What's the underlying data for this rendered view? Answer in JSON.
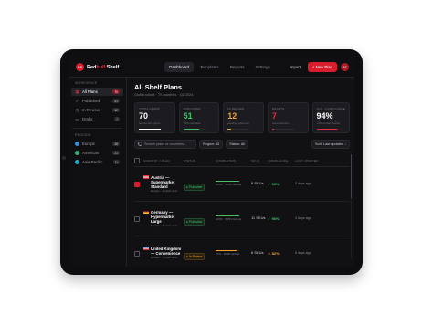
{
  "app": {
    "logo_badge": "RB",
    "brand_prefix": "Red",
    "brand_accent": "bull",
    "brand_suffix": " Shelf"
  },
  "nav": {
    "tabs": [
      "Dashboard",
      "Templates",
      "Reports",
      "Settings"
    ],
    "active_tab": "Dashboard"
  },
  "header_actions": {
    "import_label": "Import",
    "new_plan_label": "+ New Plan",
    "avatar_initials": "AT"
  },
  "sidebar": {
    "workspace_title": "WORKSPACE",
    "items": [
      {
        "label": "All Plans",
        "count": "70",
        "active": true,
        "icon": "grid-icon"
      },
      {
        "label": "Published",
        "count": "51",
        "active": false,
        "icon": "check-icon"
      },
      {
        "label": "In Review",
        "count": "12",
        "active": false,
        "icon": "clock-icon"
      },
      {
        "label": "Drafts",
        "count": "7",
        "active": false,
        "icon": "doc-icon"
      }
    ],
    "regions_title": "REGIONS",
    "regions": [
      {
        "label": "Europe",
        "count": "38",
        "color": "#3a8fd8"
      },
      {
        "label": "Americas",
        "count": "21",
        "color": "#36b37e"
      },
      {
        "label": "Asia-Pacific",
        "count": "11",
        "color": "#2ba6c9"
      }
    ]
  },
  "main": {
    "title": "All Shelf Plans",
    "subtitle": "Global rollout · 70 countries · Q2 2024"
  },
  "stats": [
    {
      "label": "TOTAL PLANS",
      "value": "70",
      "note": "across all regions",
      "color": "#ffffff",
      "bar_color": "#ffffff",
      "fill": 1.0
    },
    {
      "label": "PUBLISHED",
      "value": "51",
      "note": "73% complete",
      "color": "#47c26b",
      "bar_color": "#47c26b",
      "fill": 0.73
    },
    {
      "label": "IN REVIEW",
      "value": "12",
      "note": "awaiting approval",
      "color": "#f1a430",
      "bar_color": "#f1a430",
      "fill": 0.17
    },
    {
      "label": "DRAFTS",
      "value": "7",
      "note": "need attention",
      "color": "#e2323f",
      "bar_color": "#e2323f",
      "fill": 0.1
    },
    {
      "label": "AVG. COMPLIANCE",
      "value": "94%",
      "note": "+2% vs last quarter",
      "color": "#ffffff",
      "bar_color": "#e2323f",
      "fill": 0.94
    }
  ],
  "filters": {
    "search_placeholder": "Search plans or countries...",
    "region_label": "Region: All",
    "status_label": "Status: All",
    "sort_label": "Sort: Last updated ↓"
  },
  "table": {
    "headers": [
      "COUNTRY / PLAN",
      "STATUS",
      "COMPLETION",
      "SKUS",
      "COMPLIANCE",
      "LAST UPDATED"
    ],
    "rows": [
      {
        "name": "Austria — Supermarket Standard",
        "meta": "Europe · 4 shelf units",
        "status": "● Published",
        "status_type": "pub",
        "completion": 1.0,
        "completion_text": "100% · 36/36 facings",
        "skus": "8 SKUs",
        "compliance": "✓ 98%",
        "compliance_color": "#47c26b",
        "updated": "2 days ago",
        "checked": true,
        "flag": [
          "#e2323f",
          "#ffffff",
          "#e2323f"
        ]
      },
      {
        "name": "Germany — Hypermarket Large",
        "meta": "Europe · 6 shelf units",
        "status": "● Published",
        "status_type": "pub",
        "completion": 1.0,
        "completion_text": "100% · 54/54 facings",
        "skus": "11 SKUs",
        "compliance": "✓ 96%",
        "compliance_color": "#47c26b",
        "updated": "3 days ago",
        "checked": false,
        "flag": [
          "#111111",
          "#e2323f",
          "#f2c200"
        ]
      },
      {
        "name": "United Kingdom — Convenience",
        "meta": "Europe · 3 shelf units",
        "status": "● In Review",
        "status_type": "rev",
        "completion": 0.87,
        "completion_text": "87% · 26/30 facings",
        "skus": "6 SKUs",
        "compliance": "⚠ 82%",
        "compliance_color": "#f1a430",
        "updated": "5 days ago",
        "checked": false,
        "flag": [
          "#1f3f8f",
          "#ffffff",
          "#e2323f"
        ]
      }
    ]
  }
}
